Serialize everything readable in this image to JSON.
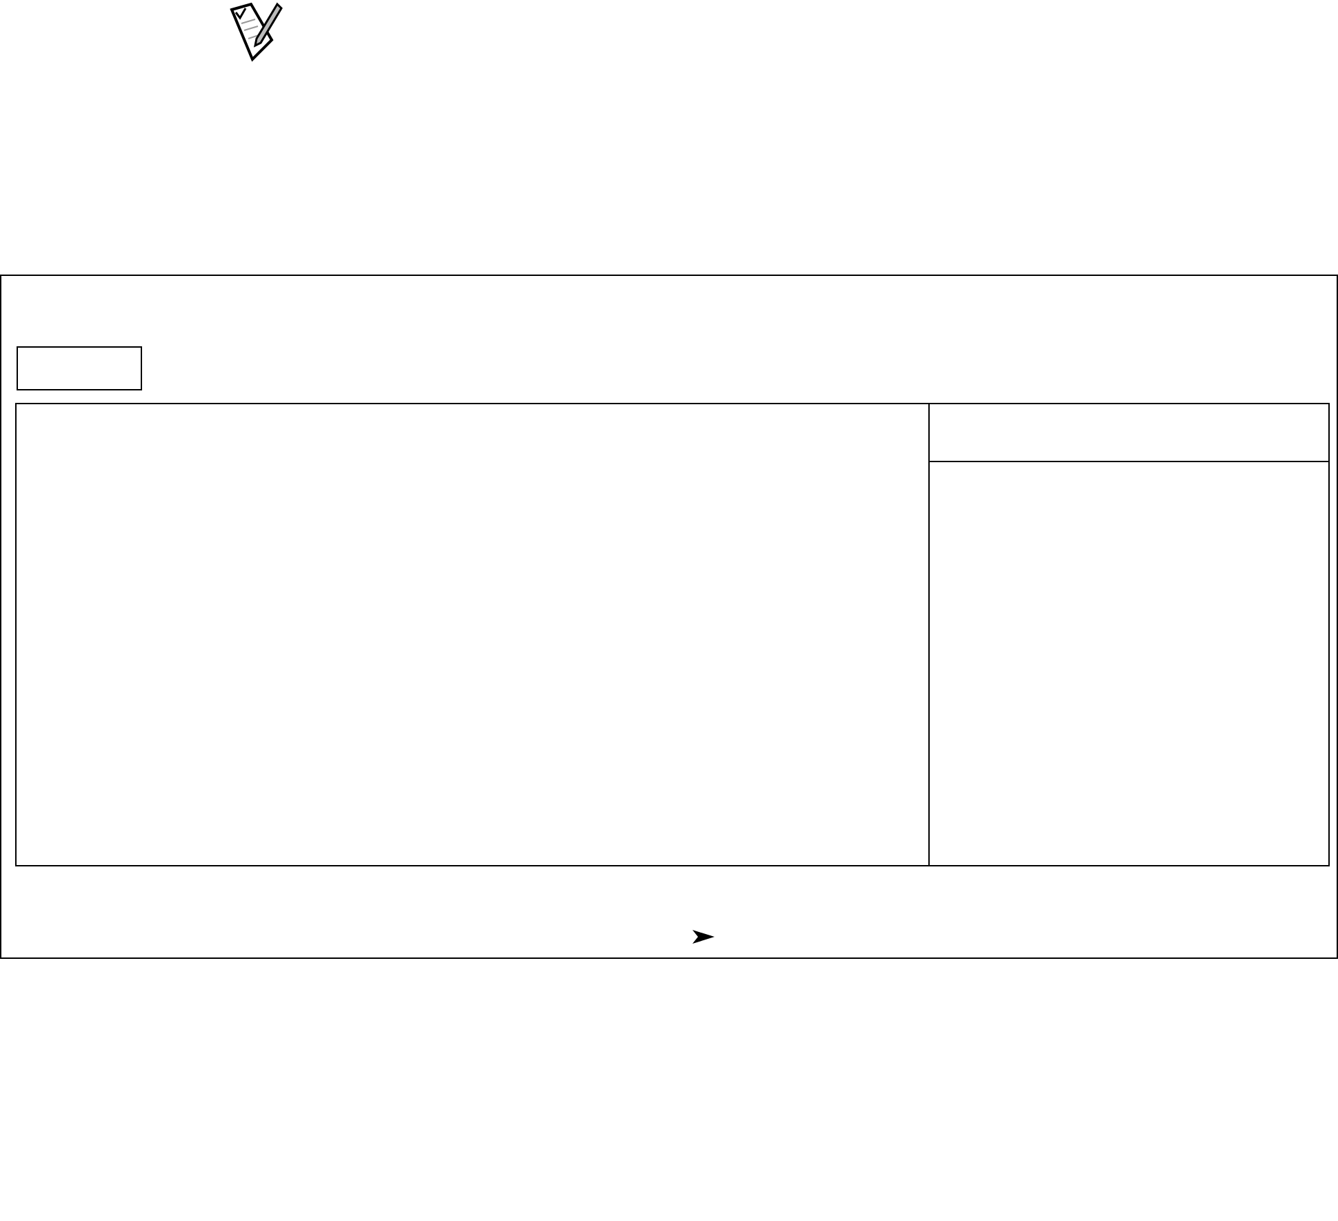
{
  "panels": [
    {
      "kind": "options"
    },
    {
      "kind": "help"
    }
  ]
}
